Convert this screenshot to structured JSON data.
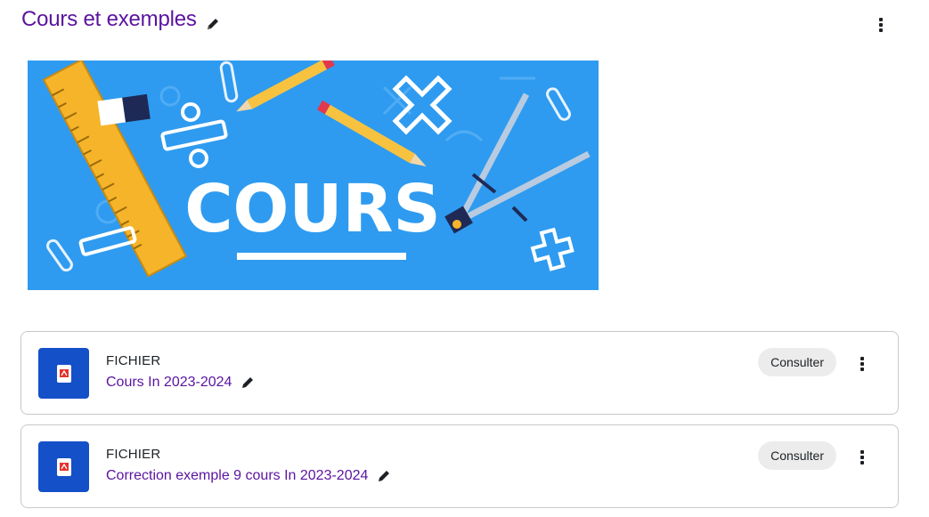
{
  "section": {
    "title": "Cours et exemples"
  },
  "banner": {
    "word": "COURS"
  },
  "activities": [
    {
      "type": "FICHIER",
      "name": "Cours In 2023-2024",
      "button": "Consulter"
    },
    {
      "type": "FICHIER",
      "name": "Correction exemple 9 cours In 2023-2024",
      "button": "Consulter"
    }
  ],
  "colors": {
    "title_purple": "#5a14a0",
    "icon_blue": "#1450c8",
    "banner_blue": "#2e9bf0",
    "pdf_red": "#e4322b"
  },
  "icons": {
    "edit": "pencil-icon",
    "menu": "kebab-menu-icon",
    "file": "pdf-file-icon"
  }
}
